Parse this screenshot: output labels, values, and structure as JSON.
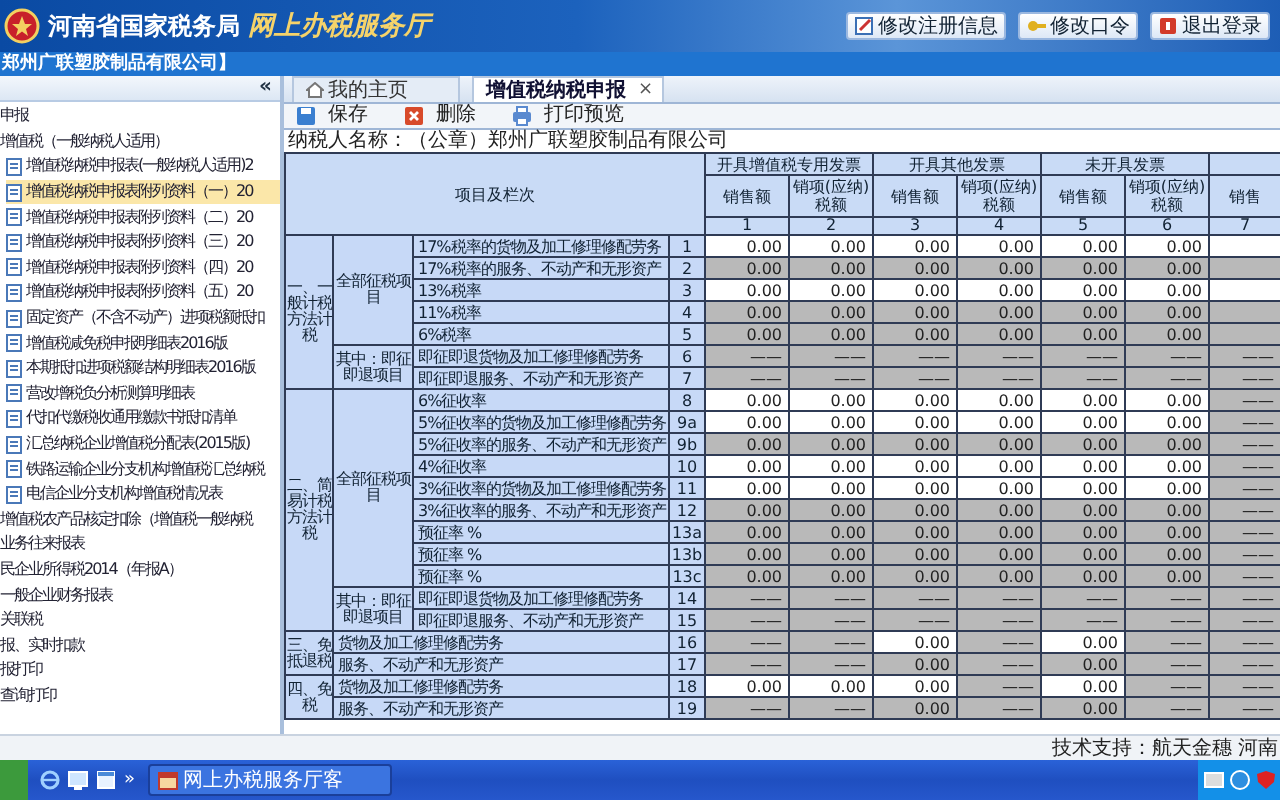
{
  "header": {
    "org": "河南省国家税务局",
    "title": "网上办税服务厅",
    "buttons": [
      {
        "label": "修改注册信息",
        "kind": "edit"
      },
      {
        "label": "修改口令",
        "kind": "key"
      },
      {
        "label": "退出登录",
        "kind": "exit"
      }
    ]
  },
  "company": "郑州广联塑胶制品有限公司】",
  "sidebar": {
    "collapse": "«",
    "tree": [
      {
        "label": "申报",
        "selected": false
      },
      {
        "label": "增值税（一般纳税人适用）",
        "selected": false,
        "children": [
          {
            "label": "增值税纳税申报表(一般纳税人适用)2",
            "selected": false
          },
          {
            "label": "增值税纳税申报表附列资料（一）20",
            "selected": true
          },
          {
            "label": "增值税纳税申报表附列资料（二）20",
            "selected": false
          },
          {
            "label": "增值税纳税申报表附列资料（三）20",
            "selected": false
          },
          {
            "label": "增值税纳税申报表附列资料（四）20",
            "selected": false
          },
          {
            "label": "增值税纳税申报表附列资料（五）20",
            "selected": false
          },
          {
            "label": "固定资产（不含不动产）进项税额抵扣",
            "selected": false
          },
          {
            "label": "增值税减免税申报明细表2016版",
            "selected": false
          },
          {
            "label": "本期抵扣进项税额结构明细表2016版",
            "selected": false
          },
          {
            "label": "营改增税负分析测算明细表",
            "selected": false
          },
          {
            "label": "代扣代缴税收通用缴款书抵扣清单",
            "selected": false
          },
          {
            "label": "汇总纳税企业增值税分配表(2015版)",
            "selected": false
          },
          {
            "label": "铁路运输企业分支机构增值税汇总纳税",
            "selected": false
          },
          {
            "label": "电信企业分支机构增值税情况表",
            "selected": false
          }
        ]
      },
      {
        "label": "增值税农产品核定扣除（增值税一般纳税",
        "selected": false
      },
      {
        "label": "业务往来报表",
        "selected": false
      },
      {
        "label": "民企业所得税2014（年报A）",
        "selected": false
      },
      {
        "label": "一般企业财务报表",
        "selected": false
      },
      {
        "label": "关联税",
        "selected": false
      },
      {
        "label": "报、实时扣款",
        "selected": false
      },
      {
        "label": "报打印",
        "selected": false
      },
      {
        "label": "查询打印",
        "selected": false
      }
    ]
  },
  "tabs": [
    {
      "label": "我的主页",
      "selected": false,
      "kind": "home"
    },
    {
      "label": "增值税纳税申报",
      "selected": true,
      "close": "×"
    }
  ],
  "toolbar": [
    {
      "label": "保存",
      "kind": "save"
    },
    {
      "label": "删除",
      "kind": "delete"
    },
    {
      "label": "打印预览",
      "kind": "print"
    }
  ],
  "taxpayer": "纳税人名称：（公章）郑州广联塑胶制品有限公司",
  "table": {
    "header_label": "项目及栏次",
    "groups": [
      "开具增值税专用发票",
      "开具其他发票",
      "未开具发票"
    ],
    "subheaders": [
      "销售额",
      "销项(应纳)税额",
      "销售额",
      "销项(应纳)税额",
      "销售额",
      "销项(应纳)税额",
      "销售"
    ],
    "numbers": [
      "1",
      "2",
      "3",
      "4",
      "5",
      "6",
      "7"
    ],
    "sections": [
      {
        "label": "一、一般计税方法计税",
        "groups": [
          {
            "label": "全部征税项目",
            "rows": [
              {
                "label": "17%税率的货物及加工修理修配劳务",
                "line": "1",
                "cells": [
                  {
                    "text": "0.00",
                    "editable": true
                  },
                  {
                    "text": "0.00",
                    "editable": true
                  },
                  {
                    "text": "0.00",
                    "editable": true
                  },
                  {
                    "text": "0.00",
                    "editable": true
                  },
                  {
                    "text": "0.00",
                    "editable": true
                  },
                  {
                    "text": "0.00",
                    "editable": true
                  },
                  {
                    "editable": true
                  }
                ]
              },
              {
                "label": "17%税率的服务、不动产和无形资产",
                "line": "2",
                "cells": [
                  {
                    "text": "0.00",
                    "editable": false
                  },
                  {
                    "text": "0.00",
                    "editable": false
                  },
                  {
                    "text": "0.00",
                    "editable": false
                  },
                  {
                    "text": "0.00",
                    "editable": false
                  },
                  {
                    "text": "0.00",
                    "editable": false
                  },
                  {
                    "text": "0.00",
                    "editable": false
                  },
                  {
                    "editable": false
                  }
                ]
              },
              {
                "label": "13%税率",
                "line": "3",
                "cells": [
                  {
                    "text": "0.00",
                    "editable": true
                  },
                  {
                    "text": "0.00",
                    "editable": true
                  },
                  {
                    "text": "0.00",
                    "editable": true
                  },
                  {
                    "text": "0.00",
                    "editable": true
                  },
                  {
                    "text": "0.00",
                    "editable": true
                  },
                  {
                    "text": "0.00",
                    "editable": true
                  },
                  {
                    "editable": true
                  }
                ]
              },
              {
                "label": "11%税率",
                "line": "4",
                "cells": [
                  {
                    "text": "0.00",
                    "editable": false
                  },
                  {
                    "text": "0.00",
                    "editable": false
                  },
                  {
                    "text": "0.00",
                    "editable": false
                  },
                  {
                    "text": "0.00",
                    "editable": false
                  },
                  {
                    "text": "0.00",
                    "editable": false
                  },
                  {
                    "text": "0.00",
                    "editable": false
                  },
                  {
                    "editable": false
                  }
                ]
              },
              {
                "label": "6%税率",
                "line": "5",
                "cells": [
                  {
                    "text": "0.00",
                    "editable": false
                  },
                  {
                    "text": "0.00",
                    "editable": false
                  },
                  {
                    "text": "0.00",
                    "editable": false
                  },
                  {
                    "text": "0.00",
                    "editable": false
                  },
                  {
                    "text": "0.00",
                    "editable": false
                  },
                  {
                    "text": "0.00",
                    "editable": false
                  },
                  {
                    "editable": false
                  }
                ]
              }
            ]
          },
          {
            "label": "其中：即征即退项目",
            "rows": [
              {
                "label": "即征即退货物及加工修理修配劳务",
                "line": "6",
                "cells": [
                  {
                    "text": "——",
                    "editable": false
                  },
                  {
                    "text": "——",
                    "editable": false
                  },
                  {
                    "text": "——",
                    "editable": false
                  },
                  {
                    "text": "——",
                    "editable": false
                  },
                  {
                    "text": "——",
                    "editable": false
                  },
                  {
                    "text": "——",
                    "editable": false
                  },
                  {
                    "text": "——",
                    "editable": false
                  }
                ]
              },
              {
                "label": "即征即退服务、不动产和无形资产",
                "line": "7",
                "cells": [
                  {
                    "text": "——",
                    "editable": false
                  },
                  {
                    "text": "——",
                    "editable": false
                  },
                  {
                    "text": "——",
                    "editable": false
                  },
                  {
                    "text": "——",
                    "editable": false
                  },
                  {
                    "text": "——",
                    "editable": false
                  },
                  {
                    "text": "——",
                    "editable": false
                  },
                  {
                    "text": "——",
                    "editable": false
                  }
                ]
              }
            ]
          }
        ]
      },
      {
        "label": "二、简易计税方法计税",
        "groups": [
          {
            "label": "全部征税项目",
            "rows": [
              {
                "label": "6%征收率",
                "line": "8",
                "cells": [
                  {
                    "text": "0.00",
                    "editable": true
                  },
                  {
                    "text": "0.00",
                    "editable": true
                  },
                  {
                    "text": "0.00",
                    "editable": true
                  },
                  {
                    "text": "0.00",
                    "editable": true
                  },
                  {
                    "text": "0.00",
                    "editable": true
                  },
                  {
                    "text": "0.00",
                    "editable": true
                  },
                  {
                    "text": "——",
                    "editable": false
                  }
                ]
              },
              {
                "label": "5%征收率的货物及加工修理修配劳务",
                "line": "9a",
                "cells": [
                  {
                    "text": "0.00",
                    "editable": true
                  },
                  {
                    "text": "0.00",
                    "editable": true
                  },
                  {
                    "text": "0.00",
                    "editable": true
                  },
                  {
                    "text": "0.00",
                    "editable": true
                  },
                  {
                    "text": "0.00",
                    "editable": true
                  },
                  {
                    "text": "0.00",
                    "editable": true
                  },
                  {
                    "text": "——",
                    "editable": false
                  }
                ]
              },
              {
                "label": "5%征收率的服务、不动产和无形资产",
                "line": "9b",
                "cells": [
                  {
                    "text": "0.00",
                    "editable": false
                  },
                  {
                    "text": "0.00",
                    "editable": false
                  },
                  {
                    "text": "0.00",
                    "editable": false
                  },
                  {
                    "text": "0.00",
                    "editable": false
                  },
                  {
                    "text": "0.00",
                    "editable": false
                  },
                  {
                    "text": "0.00",
                    "editable": false
                  },
                  {
                    "text": "——",
                    "editable": false
                  }
                ]
              },
              {
                "label": "4%征收率",
                "line": "10",
                "cells": [
                  {
                    "text": "0.00",
                    "editable": true
                  },
                  {
                    "text": "0.00",
                    "editable": true
                  },
                  {
                    "text": "0.00",
                    "editable": true
                  },
                  {
                    "text": "0.00",
                    "editable": true
                  },
                  {
                    "text": "0.00",
                    "editable": true
                  },
                  {
                    "text": "0.00",
                    "editable": true
                  },
                  {
                    "text": "——",
                    "editable": false
                  }
                ]
              },
              {
                "label": "3%征收率的货物及加工修理修配劳务",
                "line": "11",
                "cells": [
                  {
                    "text": "0.00",
                    "editable": true
                  },
                  {
                    "text": "0.00",
                    "editable": true
                  },
                  {
                    "text": "0.00",
                    "editable": true
                  },
                  {
                    "text": "0.00",
                    "editable": true
                  },
                  {
                    "text": "0.00",
                    "editable": true
                  },
                  {
                    "text": "0.00",
                    "editable": true
                  },
                  {
                    "text": "——",
                    "editable": false
                  }
                ]
              },
              {
                "label": "3%征收率的服务、不动产和无形资产",
                "line": "12",
                "cells": [
                  {
                    "text": "0.00",
                    "editable": false
                  },
                  {
                    "text": "0.00",
                    "editable": false
                  },
                  {
                    "text": "0.00",
                    "editable": false
                  },
                  {
                    "text": "0.00",
                    "editable": false
                  },
                  {
                    "text": "0.00",
                    "editable": false
                  },
                  {
                    "text": "0.00",
                    "editable": false
                  },
                  {
                    "text": "——",
                    "editable": false
                  }
                ]
              },
              {
                "label": "预征率 %",
                "line": "13a",
                "cells": [
                  {
                    "text": "0.00",
                    "editable": false
                  },
                  {
                    "text": "0.00",
                    "editable": false
                  },
                  {
                    "text": "0.00",
                    "editable": false
                  },
                  {
                    "text": "0.00",
                    "editable": false
                  },
                  {
                    "text": "0.00",
                    "editable": false
                  },
                  {
                    "text": "0.00",
                    "editable": false
                  },
                  {
                    "text": "——",
                    "editable": false
                  }
                ]
              },
              {
                "label": "预征率 %",
                "line": "13b",
                "cells": [
                  {
                    "text": "0.00",
                    "editable": false
                  },
                  {
                    "text": "0.00",
                    "editable": false
                  },
                  {
                    "text": "0.00",
                    "editable": false
                  },
                  {
                    "text": "0.00",
                    "editable": false
                  },
                  {
                    "text": "0.00",
                    "editable": false
                  },
                  {
                    "text": "0.00",
                    "editable": false
                  },
                  {
                    "text": "——",
                    "editable": false
                  }
                ]
              },
              {
                "label": "预征率 %",
                "line": "13c",
                "cells": [
                  {
                    "text": "0.00",
                    "editable": false
                  },
                  {
                    "text": "0.00",
                    "editable": false
                  },
                  {
                    "text": "0.00",
                    "editable": false
                  },
                  {
                    "text": "0.00",
                    "editable": false
                  },
                  {
                    "text": "0.00",
                    "editable": false
                  },
                  {
                    "text": "0.00",
                    "editable": false
                  },
                  {
                    "text": "——",
                    "editable": false
                  }
                ]
              }
            ]
          },
          {
            "label": "其中：即征即退项目",
            "rows": [
              {
                "label": "即征即退货物及加工修理修配劳务",
                "line": "14",
                "cells": [
                  {
                    "text": "——",
                    "editable": false
                  },
                  {
                    "text": "——",
                    "editable": false
                  },
                  {
                    "text": "——",
                    "editable": false
                  },
                  {
                    "text": "——",
                    "editable": false
                  },
                  {
                    "text": "——",
                    "editable": false
                  },
                  {
                    "text": "——",
                    "editable": false
                  },
                  {
                    "text": "——",
                    "editable": false
                  }
                ]
              },
              {
                "label": "即征即退服务、不动产和无形资产",
                "line": "15",
                "cells": [
                  {
                    "text": "——",
                    "editable": false
                  },
                  {
                    "text": "——",
                    "editable": false
                  },
                  {
                    "text": "——",
                    "editable": false
                  },
                  {
                    "text": "——",
                    "editable": false
                  },
                  {
                    "text": "——",
                    "editable": false
                  },
                  {
                    "text": "——",
                    "editable": false
                  },
                  {
                    "text": "——",
                    "editable": false
                  }
                ]
              }
            ]
          }
        ]
      },
      {
        "label": "三、免抵退税",
        "rows": [
          {
            "label": "货物及加工修理修配劳务",
            "line": "16",
            "cells": [
              {
                "text": "——",
                "editable": false
              },
              {
                "text": "——",
                "editable": false
              },
              {
                "text": "0.00",
                "editable": true
              },
              {
                "text": "——",
                "editable": false
              },
              {
                "text": "0.00",
                "editable": true
              },
              {
                "text": "——",
                "editable": false
              },
              {
                "text": "——",
                "editable": false
              }
            ]
          },
          {
            "label": "服务、不动产和无形资产",
            "line": "17",
            "cells": [
              {
                "text": "——",
                "editable": false
              },
              {
                "text": "——",
                "editable": false
              },
              {
                "text": "0.00",
                "editable": false
              },
              {
                "text": "——",
                "editable": false
              },
              {
                "text": "0.00",
                "editable": false
              },
              {
                "text": "——",
                "editable": false
              },
              {
                "text": "——",
                "editable": false
              }
            ]
          }
        ]
      },
      {
        "label": "四、免税",
        "rows": [
          {
            "label": "货物及加工修理修配劳务",
            "line": "18",
            "cells": [
              {
                "text": "0.00",
                "editable": true
              },
              {
                "text": "0.00",
                "editable": true
              },
              {
                "text": "0.00",
                "editable": true
              },
              {
                "text": "——",
                "editable": false
              },
              {
                "text": "0.00",
                "editable": true
              },
              {
                "text": "——",
                "editable": false
              },
              {
                "text": "——",
                "editable": false
              }
            ]
          },
          {
            "label": "服务、不动产和无形资产",
            "line": "19",
            "cells": [
              {
                "text": "——",
                "editable": false
              },
              {
                "text": "——",
                "editable": false
              },
              {
                "text": "0.00",
                "editable": false
              },
              {
                "text": "——",
                "editable": false
              },
              {
                "text": "0.00",
                "editable": false
              },
              {
                "text": "——",
                "editable": false
              },
              {
                "text": "——",
                "editable": false
              }
            ]
          }
        ]
      }
    ]
  },
  "footer": "技术支持：航天金穗 河南",
  "taskbar": {
    "quick_launch_more": "»",
    "task": "网上办税服务厅客"
  }
}
